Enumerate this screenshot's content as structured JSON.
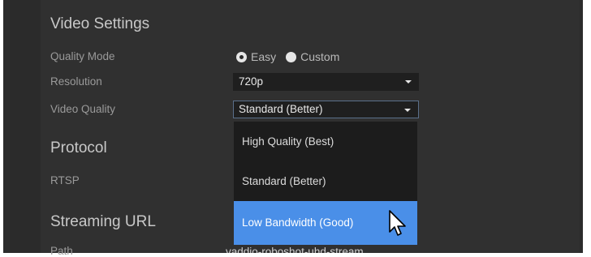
{
  "video_settings": {
    "title": "Video Settings",
    "quality_mode": {
      "label": "Quality Mode",
      "options": [
        {
          "label": "Easy",
          "checked": true
        },
        {
          "label": "Custom",
          "checked": false
        }
      ]
    },
    "resolution": {
      "label": "Resolution",
      "value": "720p"
    },
    "video_quality": {
      "label": "Video Quality",
      "value": "Standard (Better)",
      "dropdown_options": [
        {
          "label": "High Quality (Best)",
          "hovered": false
        },
        {
          "label": "Standard (Better)",
          "hovered": false
        },
        {
          "label": "Low Bandwidth (Good)",
          "hovered": true
        }
      ]
    }
  },
  "protocol": {
    "title": "Protocol",
    "rtsp_label": "RTSP"
  },
  "streaming_url": {
    "title": "Streaming URL",
    "path_label": "Path",
    "path_value": "vaddio-roboshot-uhd-stream"
  },
  "colors": {
    "background": "#2b2b2b",
    "select_bg": "#1f1f1f",
    "highlight": "#4a8fe8",
    "label_text": "#9a9a9a"
  },
  "icons": {
    "select_caret": "chevron-down-icon",
    "cursor": "mouse-pointer-icon"
  }
}
